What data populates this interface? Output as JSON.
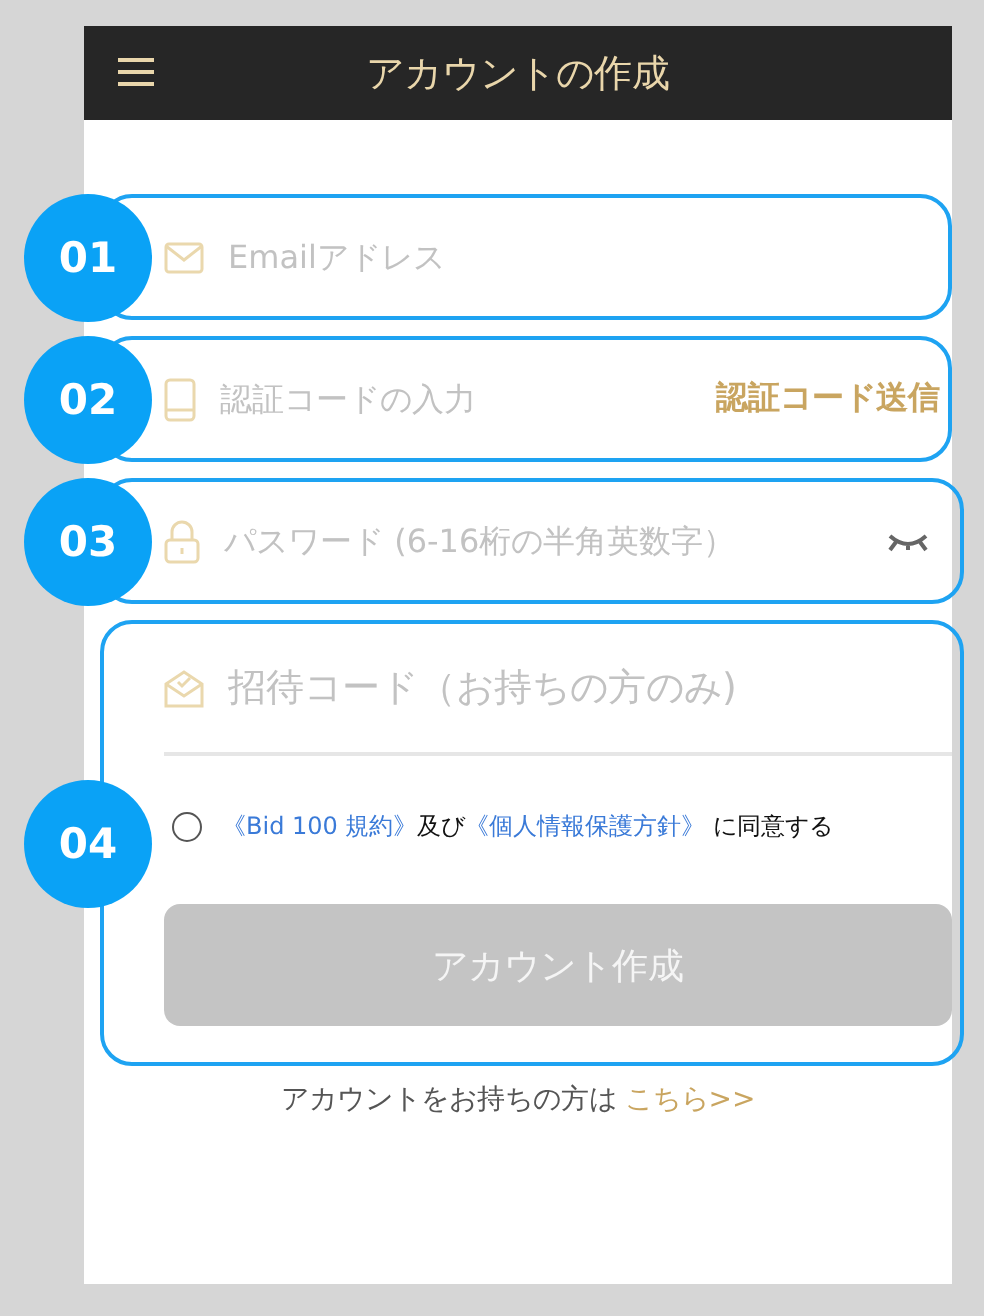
{
  "header": {
    "title": "アカウントの作成"
  },
  "fields": [
    {
      "marker": "01",
      "kind": "email",
      "placeholder": "Emailアドレス"
    },
    {
      "marker": "02",
      "kind": "code",
      "placeholder": "認証コードの入力",
      "action": "認証コード送信"
    },
    {
      "marker": "03",
      "kind": "password",
      "placeholder": "パスワード (6-16桁の半角英数字）"
    }
  ],
  "signup": {
    "marker": "04",
    "invite": {
      "placeholder": "招待コード（お持ちの方のみ)"
    },
    "agreement": {
      "checked": false,
      "parts": [
        {
          "kind": "link",
          "text": "《Bid 100 規約》"
        },
        {
          "kind": "text",
          "text": "及び"
        },
        {
          "kind": "link",
          "text": "《個人情報保護方針》"
        },
        {
          "kind": "text",
          "text": " に同意する"
        }
      ]
    },
    "submit": {
      "label": "アカウント作成",
      "disabled": true
    }
  },
  "footer": {
    "text": "アカウントをお持ちの方は",
    "link": "こちら>>"
  }
}
